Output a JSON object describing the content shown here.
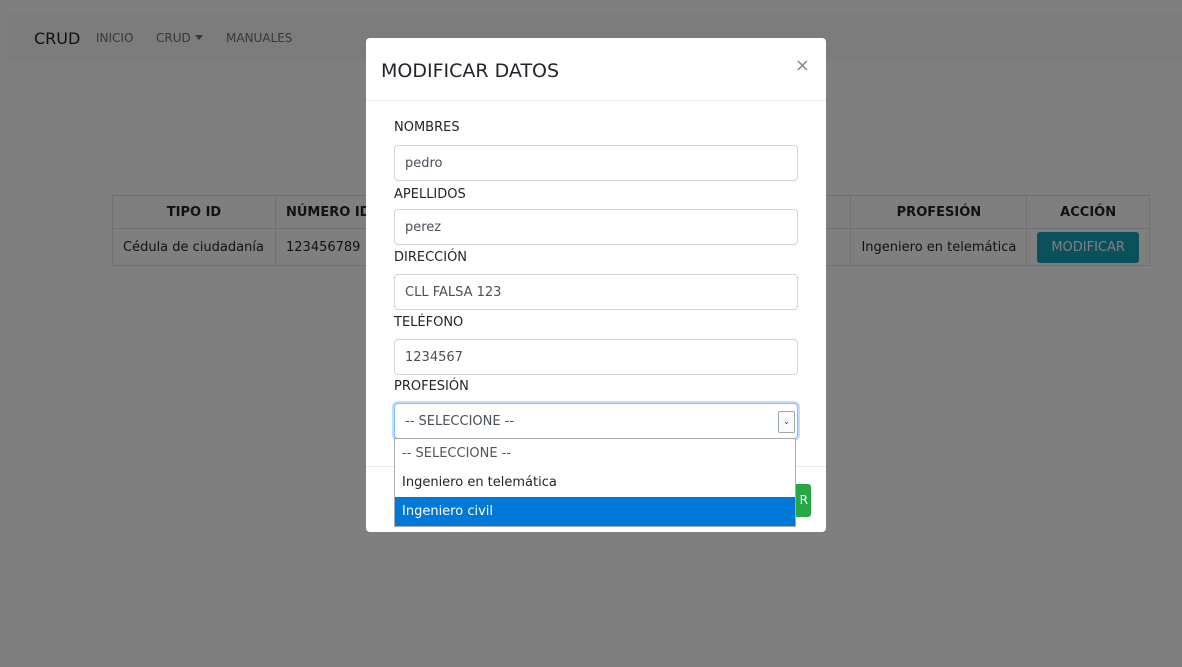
{
  "navbar": {
    "brand": "CRUD",
    "links": [
      "INICIO",
      "CRUD",
      "MANUALES"
    ]
  },
  "table": {
    "headers": [
      "TIPO ID",
      "NÚMERO ID",
      "PROFESIÓN",
      "ACCIÓN"
    ],
    "row": {
      "tipo_id": "Cédula de ciudadanía",
      "numero_id": "123456789",
      "profesion": "Ingeniero en telemática",
      "accion_label": "MODIFICAR"
    }
  },
  "modal": {
    "title": "MODIFICAR DATOS",
    "close_glyph": "×",
    "fields": {
      "nombres": {
        "label": "NOMBRES",
        "value": "pedro"
      },
      "apellidos": {
        "label": "APELLIDOS",
        "value": "perez"
      },
      "direccion": {
        "label": "DIRECCIÓN",
        "value": "CLL FALSA 123"
      },
      "telefono": {
        "label": "TELÉFONO",
        "value": "1234567"
      },
      "profesion": {
        "label": "PROFESIÓN",
        "selected": "-- SELECCIONE --"
      }
    },
    "dropdown_options": [
      "-- SELECCIONE --",
      "Ingeniero en telemática",
      "Ingeniero civil"
    ],
    "save_button_fragment": "R"
  },
  "colors": {
    "accent_info": "#17a2b8",
    "success": "#28a745",
    "highlight": "#0078d7"
  }
}
